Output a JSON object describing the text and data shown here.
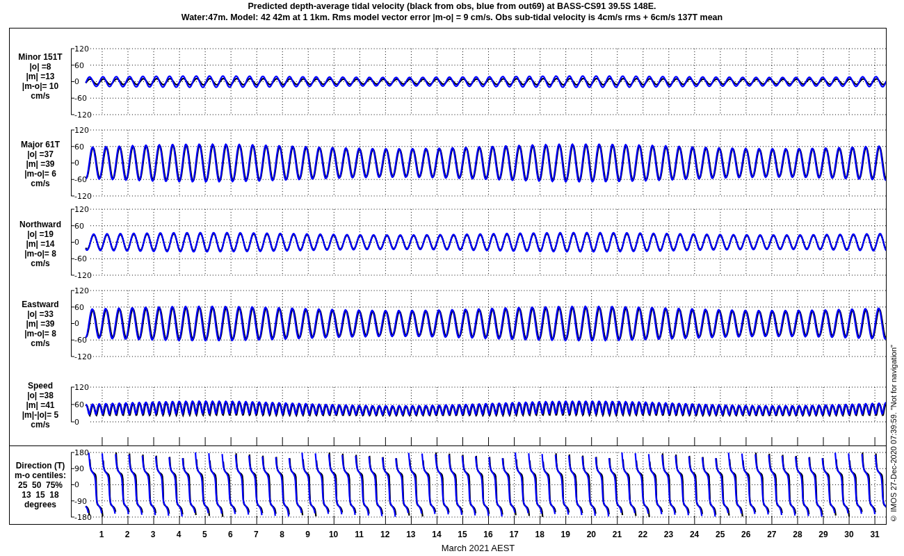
{
  "title": {
    "line_1": "Predicted depth-average tidal velocity (black from obs, blue from out69) at BASS-CS91 39.5S 148E.",
    "line_2": "Water:47m. Model: 42 42m at 1 1km. Rms model vector error |m-o| = 9 cm/s. Obs sub-tidal velocity is 4cm/s rms + 6cm/s 137T mean"
  },
  "panels": [
    {
      "kind": "minor",
      "label_lines": [
        "Minor 151T",
        "|o| =8",
        "|m| =13",
        "|m-o|= 10",
        "cm/s"
      ],
      "yticks": [
        "120",
        "60",
        "0",
        "-60",
        "-120"
      ]
    },
    {
      "kind": "major",
      "label_lines": [
        "Major 61T",
        "|o| =37",
        "|m| =39",
        "|m-o|= 6",
        "cm/s"
      ],
      "yticks": [
        "120",
        "60",
        "0",
        "-60",
        "-120"
      ]
    },
    {
      "kind": "northward",
      "label_lines": [
        "Northward",
        "|o| =19",
        "|m| =14",
        "|m-o|= 8",
        "cm/s"
      ],
      "yticks": [
        "120",
        "60",
        "0",
        "-60",
        "-120"
      ]
    },
    {
      "kind": "eastward",
      "label_lines": [
        "Eastward",
        "|o| =33",
        "|m| =39",
        "|m-o|= 8",
        "cm/s"
      ],
      "yticks": [
        "120",
        "60",
        "0",
        "-60",
        "-120"
      ]
    },
    {
      "kind": "speed",
      "label_lines": [
        "Speed",
        "|o| =38",
        "|m| =41",
        "|m|-|o|= 5",
        "cm/s"
      ],
      "yticks": [
        "120",
        "60",
        "0"
      ]
    },
    {
      "kind": "direction",
      "label_lines": [
        "Direction (T)",
        "m-o centiles:",
        "25  50  75%",
        "13  15  18",
        "degrees"
      ],
      "yticks": [
        "180",
        "90",
        "0",
        "-90",
        "-180"
      ]
    }
  ],
  "x_axis": {
    "day_labels": [
      "1",
      "2",
      "3",
      "4",
      "5",
      "6",
      "7",
      "8",
      "9",
      "10",
      "11",
      "12",
      "13",
      "14",
      "15",
      "16",
      "17",
      "18",
      "19",
      "20",
      "21",
      "22",
      "23",
      "24",
      "25",
      "26",
      "27",
      "28",
      "29",
      "30",
      "31"
    ],
    "label": "March 2021 AEST"
  },
  "side_note": "© IMOS 27-Dec-2020 07:39:59. \"Not for navigation\""
}
